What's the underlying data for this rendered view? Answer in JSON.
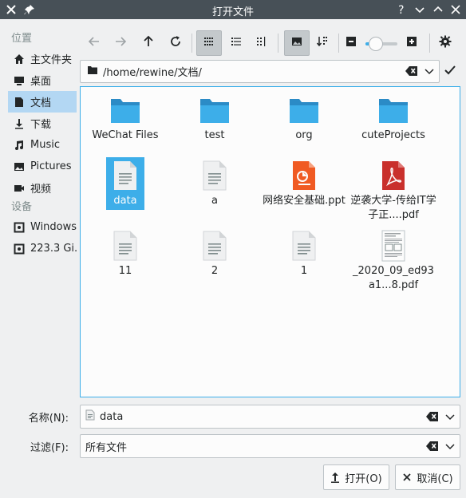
{
  "window": {
    "title": "打开文件"
  },
  "sidebar": {
    "places_header": "位置",
    "places": [
      {
        "label": "主文件夹",
        "icon": "home-icon"
      },
      {
        "label": "桌面",
        "icon": "desktop-icon"
      },
      {
        "label": "文档",
        "icon": "document-icon",
        "selected": true
      },
      {
        "label": "下载",
        "icon": "download-icon"
      },
      {
        "label": "Music",
        "icon": "music-icon"
      },
      {
        "label": "Pictures",
        "icon": "pictures-icon"
      },
      {
        "label": "视频",
        "icon": "video-icon"
      }
    ],
    "devices_header": "设备",
    "devices": [
      {
        "label": "Windows",
        "icon": "drive-icon"
      },
      {
        "label": "223.3 Gi...",
        "icon": "drive-icon"
      }
    ]
  },
  "path": {
    "value": "/home/rewine/文档/"
  },
  "files": [
    {
      "name": "WeChat Files",
      "type": "folder"
    },
    {
      "name": "test",
      "type": "folder"
    },
    {
      "name": "org",
      "type": "folder"
    },
    {
      "name": "cuteProjects",
      "type": "folder"
    },
    {
      "name": "data",
      "type": "text",
      "selected": true
    },
    {
      "name": "a",
      "type": "text"
    },
    {
      "name": "网络安全基础.ppt",
      "type": "ppt"
    },
    {
      "name": "逆袭大学-传给IT学子正....pdf",
      "type": "pdf"
    },
    {
      "name": "11",
      "type": "text"
    },
    {
      "name": "2",
      "type": "text"
    },
    {
      "name": "1",
      "type": "text"
    },
    {
      "name": "_2020_09_ed93a1...8.pdf",
      "type": "pdf-thumb"
    }
  ],
  "form": {
    "name_label": "名称(N):",
    "name_value": "data",
    "filter_label": "过滤(F):",
    "filter_value": "所有文件"
  },
  "buttons": {
    "open": "打开(O)",
    "cancel": "取消(C)"
  },
  "colors": {
    "accent": "#3daee9",
    "titlebar": "#475057",
    "folder": "#3daee9",
    "ppt": "#f05a22",
    "pdf": "#c9302c"
  }
}
